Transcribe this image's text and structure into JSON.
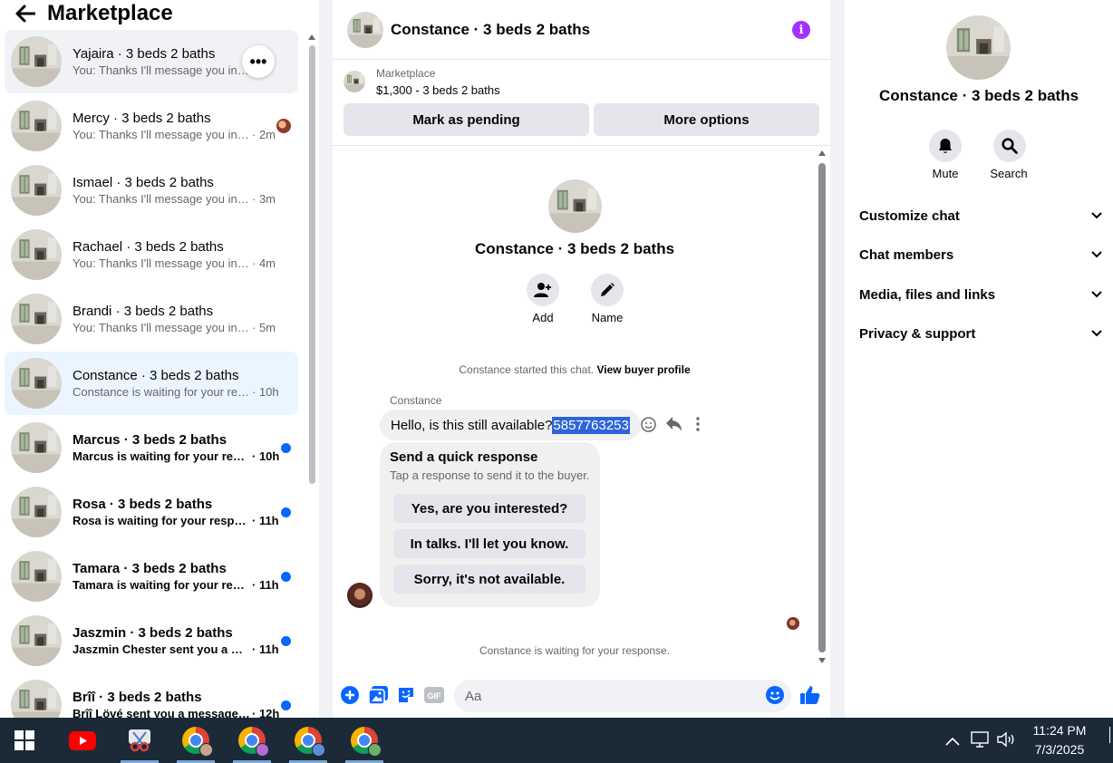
{
  "sidebar": {
    "title": "Marketplace",
    "conversations": [
      {
        "name": "Yajaira · 3 beds 2 baths",
        "preview": "You: Thanks I'll message you in a ...",
        "time": "",
        "state": "hover",
        "unread": false
      },
      {
        "name": "Mercy · 3 beds 2 baths",
        "preview": "You: Thanks I'll message you in ...",
        "time": "· 2m",
        "state": "",
        "unread": false,
        "seen_avatar": true
      },
      {
        "name": "Ismael · 3 beds 2 baths",
        "preview": "You: Thanks I'll message you in a ...",
        "time": "· 3m",
        "state": "",
        "unread": false
      },
      {
        "name": "Rachael · 3 beds 2 baths",
        "preview": "You: Thanks I'll message you in a ...",
        "time": "· 4m",
        "state": "",
        "unread": false
      },
      {
        "name": "Brandi · 3 beds 2 baths",
        "preview": "You: Thanks I'll message you in a ...",
        "time": "· 5m",
        "state": "",
        "unread": false
      },
      {
        "name": "Constance · 3 beds 2 baths",
        "preview": "Constance is waiting for your resp...",
        "time": "· 10h",
        "state": "active",
        "unread": false
      },
      {
        "name": "Marcus · 3 beds 2 baths",
        "preview": "Marcus is waiting for your resp...",
        "time": "· 10h",
        "state": "",
        "unread": true
      },
      {
        "name": "Rosa · 3 beds 2 baths",
        "preview": "Rosa is waiting for your respo...",
        "time": "· 11h",
        "state": "",
        "unread": true
      },
      {
        "name": "Tamara · 3 beds 2 baths",
        "preview": "Tamara is waiting for your resp...",
        "time": "· 11h",
        "state": "",
        "unread": true
      },
      {
        "name": "Jaszmin · 3 beds 2 baths",
        "preview": "Jaszmin Chester sent you a me...",
        "time": "· 11h",
        "state": "",
        "unread": true
      },
      {
        "name": "Brîî · 3 beds 2 baths",
        "preview": "Brîî Lövé sent you a message a...",
        "time": "· 12h",
        "state": "",
        "unread": true
      }
    ]
  },
  "chat": {
    "title": "Constance · 3 beds 2 baths",
    "listing_source": "Marketplace",
    "listing_price": "$1,300 - 3 beds 2 baths",
    "mark_pending_label": "Mark as pending",
    "more_options_label": "More options",
    "intro_name": "Constance · 3 beds 2 baths",
    "add_label": "Add",
    "name_label": "Name",
    "started_text": "Constance started this chat.",
    "view_profile_label": "View buyer profile",
    "sender": "Constance",
    "message_text": "Hello, is this still available?",
    "message_selected": "5857763253",
    "quick_title": "Send a quick response",
    "quick_subtitle": "Tap a response to send it to the buyer.",
    "quick_responses": [
      "Yes, are you interested?",
      "In talks. I'll let you know.",
      "Sorry, it's not available."
    ],
    "waiting_text": "Constance is waiting for your response.",
    "input_placeholder": "Aa"
  },
  "info_panel": {
    "name": "Constance · 3 beds 2 baths",
    "mute_label": "Mute",
    "search_label": "Search",
    "sections": [
      "Customize chat",
      "Chat members",
      "Media, files and links",
      "Privacy & support"
    ]
  },
  "taskbar": {
    "time": "11:24 PM",
    "date": "7/3/2025"
  },
  "colors": {
    "accent": "#0866ff",
    "info": "#a033ff",
    "selection": "#2e64d8",
    "taskbar": "#1c2a37"
  }
}
